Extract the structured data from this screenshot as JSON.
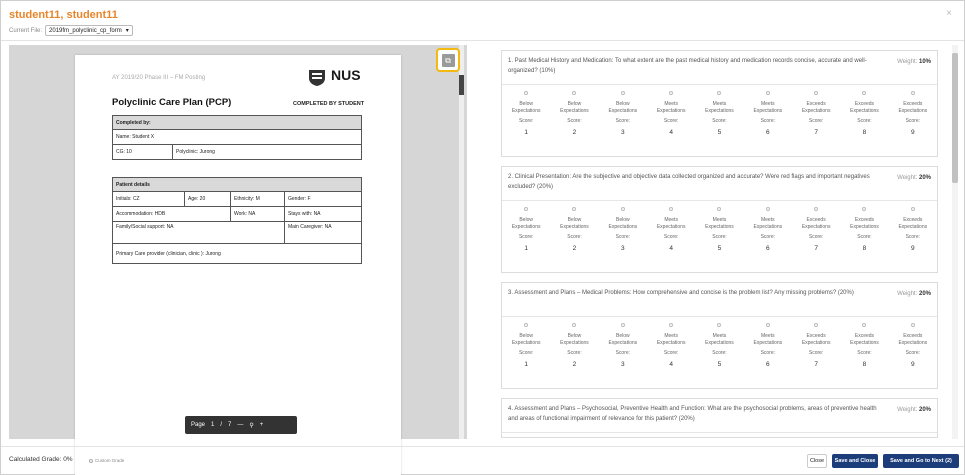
{
  "header": {
    "title": "student11, student11",
    "current_file_label": "Current File:",
    "current_file_value": "2019fm_polyclinic_cp_form",
    "close_glyph": "×"
  },
  "pdf": {
    "phase": "AY 2019/20 Phase III – FM Posting",
    "title": "Polyclinic Care Plan (PCP)",
    "logo_text": "NUS",
    "completed_by_student": "COMPLETED BY STUDENT",
    "completed_by": "Completed by:",
    "name": "Name: Student X",
    "cg": "CG: 10",
    "polyclinic": "Polyclinic: Jurong",
    "patient_details": "Patient details",
    "initials": "Initials: CZ",
    "age": "Age:  20",
    "ethnicity": "Ethnicity: M",
    "gender": "Gender: F",
    "accommodation": "Accommodation: HDB",
    "work": "Work: NA",
    "stays_with": "Stays with: NA",
    "family_support": "Family/Social support: NA",
    "main_caregiver": "Main Caregiver: NA",
    "primary_care": "Primary Care provider (clinician, clinic ): Jurong",
    "toolbar": {
      "page_label": "Page",
      "page_current": "1",
      "page_sep": "/",
      "page_total": "7",
      "zoom_out": "—",
      "zoom_icon": "⚲",
      "zoom_in": "+"
    }
  },
  "questions": [
    {
      "text": "1. Past Medical History and Medication: To what extent are the past medical history and medication records concise, accurate and well- organized? (10%)",
      "weight_label": "Weight:",
      "weight_value": "10%"
    },
    {
      "text": "2. Clinical Presentation: Are the subjective and objective data collected organized and accurate? Were red flags and important negatives excluded? (20%)",
      "weight_label": "Weight:",
      "weight_value": "20%"
    },
    {
      "text": "3. Assessment and Plans – Medical Problems: How comprehensive and concise is the problem list? Any missing problems? (20%)",
      "weight_label": "Weight:",
      "weight_value": "20%"
    },
    {
      "text": "4. Assessment and Plans – Psychosocial, Preventive Health and Function: What are the psychosocial problems, areas of preventive health and areas of functional impairment of relevance for this patient? (20%)",
      "weight_label": "Weight:",
      "weight_value": "20%"
    }
  ],
  "score_options": [
    {
      "label1": "Below",
      "label2": "Expectations",
      "score_label": "Score:",
      "value": "1"
    },
    {
      "label1": "Below",
      "label2": "Expectations",
      "score_label": "Score:",
      "value": "2"
    },
    {
      "label1": "Below",
      "label2": "Expectations",
      "score_label": "Score:",
      "value": "3"
    },
    {
      "label1": "Meets",
      "label2": "Expectations",
      "score_label": "Score:",
      "value": "4"
    },
    {
      "label1": "Meets",
      "label2": "Expectations",
      "score_label": "Score:",
      "value": "5"
    },
    {
      "label1": "Meets",
      "label2": "Expectations",
      "score_label": "Score:",
      "value": "6"
    },
    {
      "label1": "Exceeds",
      "label2": "Expectations",
      "score_label": "Score:",
      "value": "7"
    },
    {
      "label1": "Exceeds",
      "label2": "Expectations",
      "score_label": "Score:",
      "value": "8"
    },
    {
      "label1": "Exceeds",
      "label2": "Expectations",
      "score_label": "Score:",
      "value": "9"
    }
  ],
  "footer": {
    "calculated_grade": "Calculated Grade: 0%",
    "custom_grade": "Custom Grade",
    "close": "Close",
    "save_close": "Save and Close",
    "save_next": "Save and Go to Next (2)"
  },
  "colors": {
    "accent": "#e8852a",
    "primary_button": "#1c3d7a",
    "highlight": "#f2b90f"
  }
}
